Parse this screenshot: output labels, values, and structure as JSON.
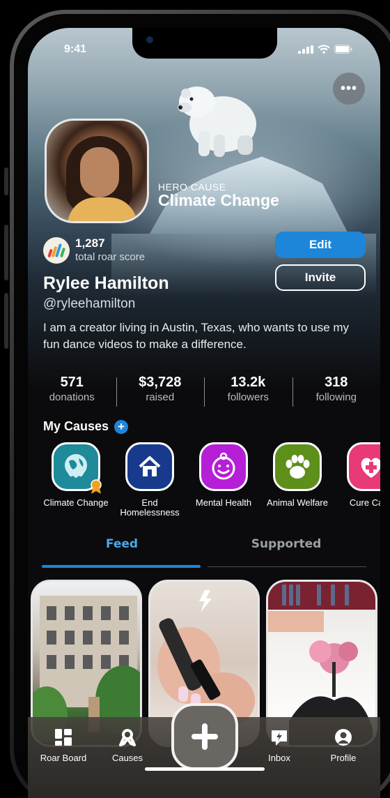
{
  "status_bar": {
    "time": "9:41"
  },
  "hero": {
    "label": "HERO CAUSE",
    "cause_name": "Climate Change"
  },
  "profile": {
    "roar_score": "1,287",
    "roar_label": "total roar score",
    "name": "Rylee Hamilton",
    "handle": "@ryleehamilton",
    "bio": "I am a creator living in Austin, Texas, who wants to use my fun dance videos to make a difference."
  },
  "actions": {
    "edit_label": "Edit",
    "invite_label": "Invite"
  },
  "stats": [
    {
      "value": "571",
      "label": "donations"
    },
    {
      "value": "$3,728",
      "label": "raised"
    },
    {
      "value": "13.2k",
      "label": "followers"
    },
    {
      "value": "318",
      "label": "following"
    }
  ],
  "my_causes": {
    "title": "My Causes",
    "items": [
      {
        "label": "Climate Change",
        "color": "#1e8a9a",
        "icon": "globe-icon"
      },
      {
        "label": "End Homelessness",
        "color": "#173a8c",
        "icon": "house-icon"
      },
      {
        "label": "Mental Health",
        "color": "#b51fd6",
        "icon": "smile-icon"
      },
      {
        "label": "Animal Welfare",
        "color": "#5e8f1a",
        "icon": "paw-icon"
      },
      {
        "label": "Cure Canc",
        "color": "#e83a78",
        "icon": "heart-plus-icon"
      }
    ]
  },
  "tabs": {
    "feed": "Feed",
    "supported": "Supported"
  },
  "bottom_nav": {
    "roar_board": "Roar Board",
    "causes": "Causes",
    "inbox": "Inbox",
    "profile": "Profile"
  },
  "colors": {
    "accent": "#1d86d8",
    "background": "#0b0b0d"
  }
}
